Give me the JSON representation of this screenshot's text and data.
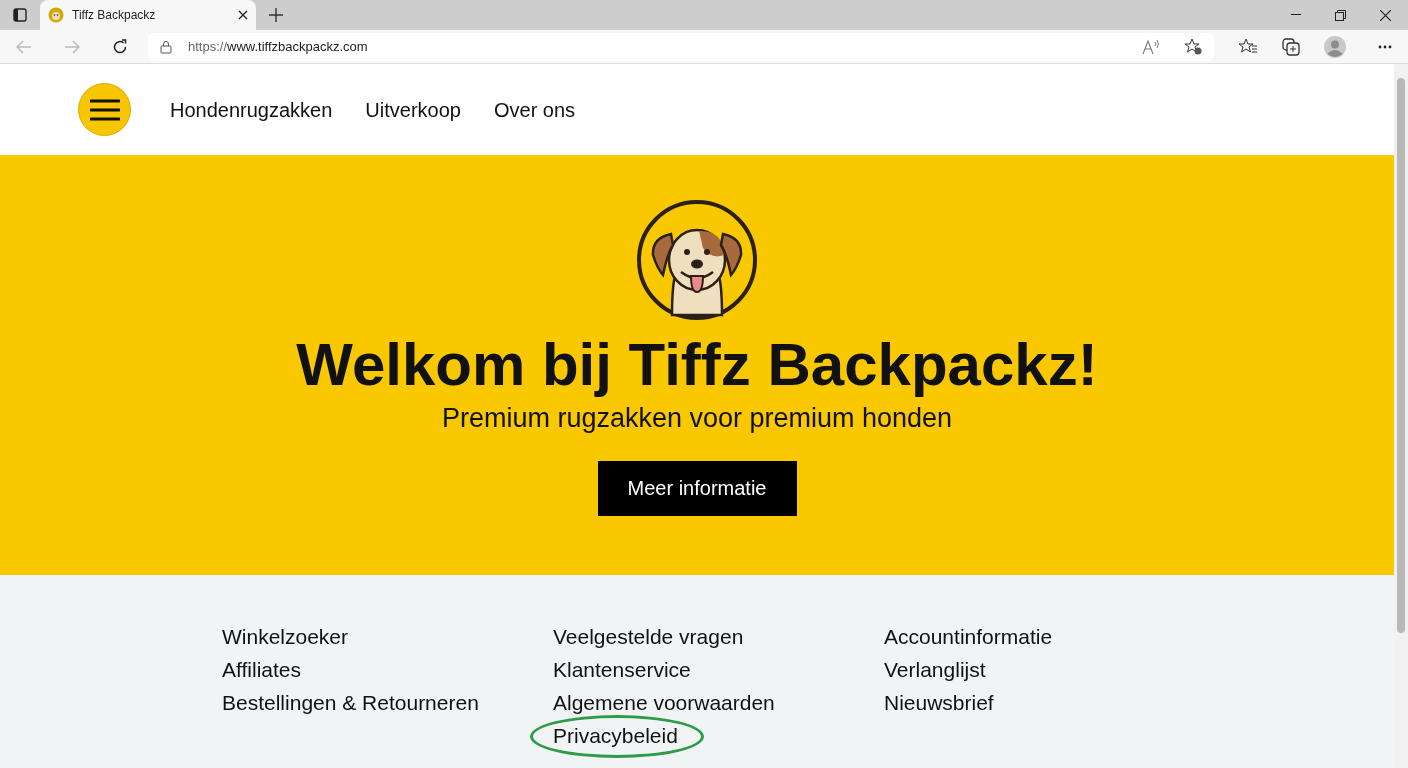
{
  "browser": {
    "tab_title": "Tiffz Backpackz",
    "url_scheme": "https://",
    "url_host": "www.tiffzbackpackz.com"
  },
  "nav": {
    "items": [
      "Hondenrugzakken",
      "Uitverkoop",
      "Over ons"
    ]
  },
  "hero": {
    "title": "Welkom bij Tiffz Backpackz!",
    "subtitle": "Premium rugzakken voor premium honden",
    "button": "Meer informatie"
  },
  "footer": {
    "columns": [
      {
        "links": [
          {
            "label": "Winkelzoeker",
            "highlighted": false
          },
          {
            "label": "Affiliates",
            "highlighted": false
          },
          {
            "label": "Bestellingen & Retourneren",
            "highlighted": false
          }
        ]
      },
      {
        "links": [
          {
            "label": "Veelgestelde vragen",
            "highlighted": false
          },
          {
            "label": "Klantenservice",
            "highlighted": false
          },
          {
            "label": "Algemene voorwaarden",
            "highlighted": false
          },
          {
            "label": "Privacybeleid",
            "highlighted": true
          }
        ]
      },
      {
        "links": [
          {
            "label": "Accountinformatie",
            "highlighted": false
          },
          {
            "label": "Verlanglijst",
            "highlighted": false
          },
          {
            "label": "Nieuwsbrief",
            "highlighted": false
          }
        ]
      }
    ]
  }
}
